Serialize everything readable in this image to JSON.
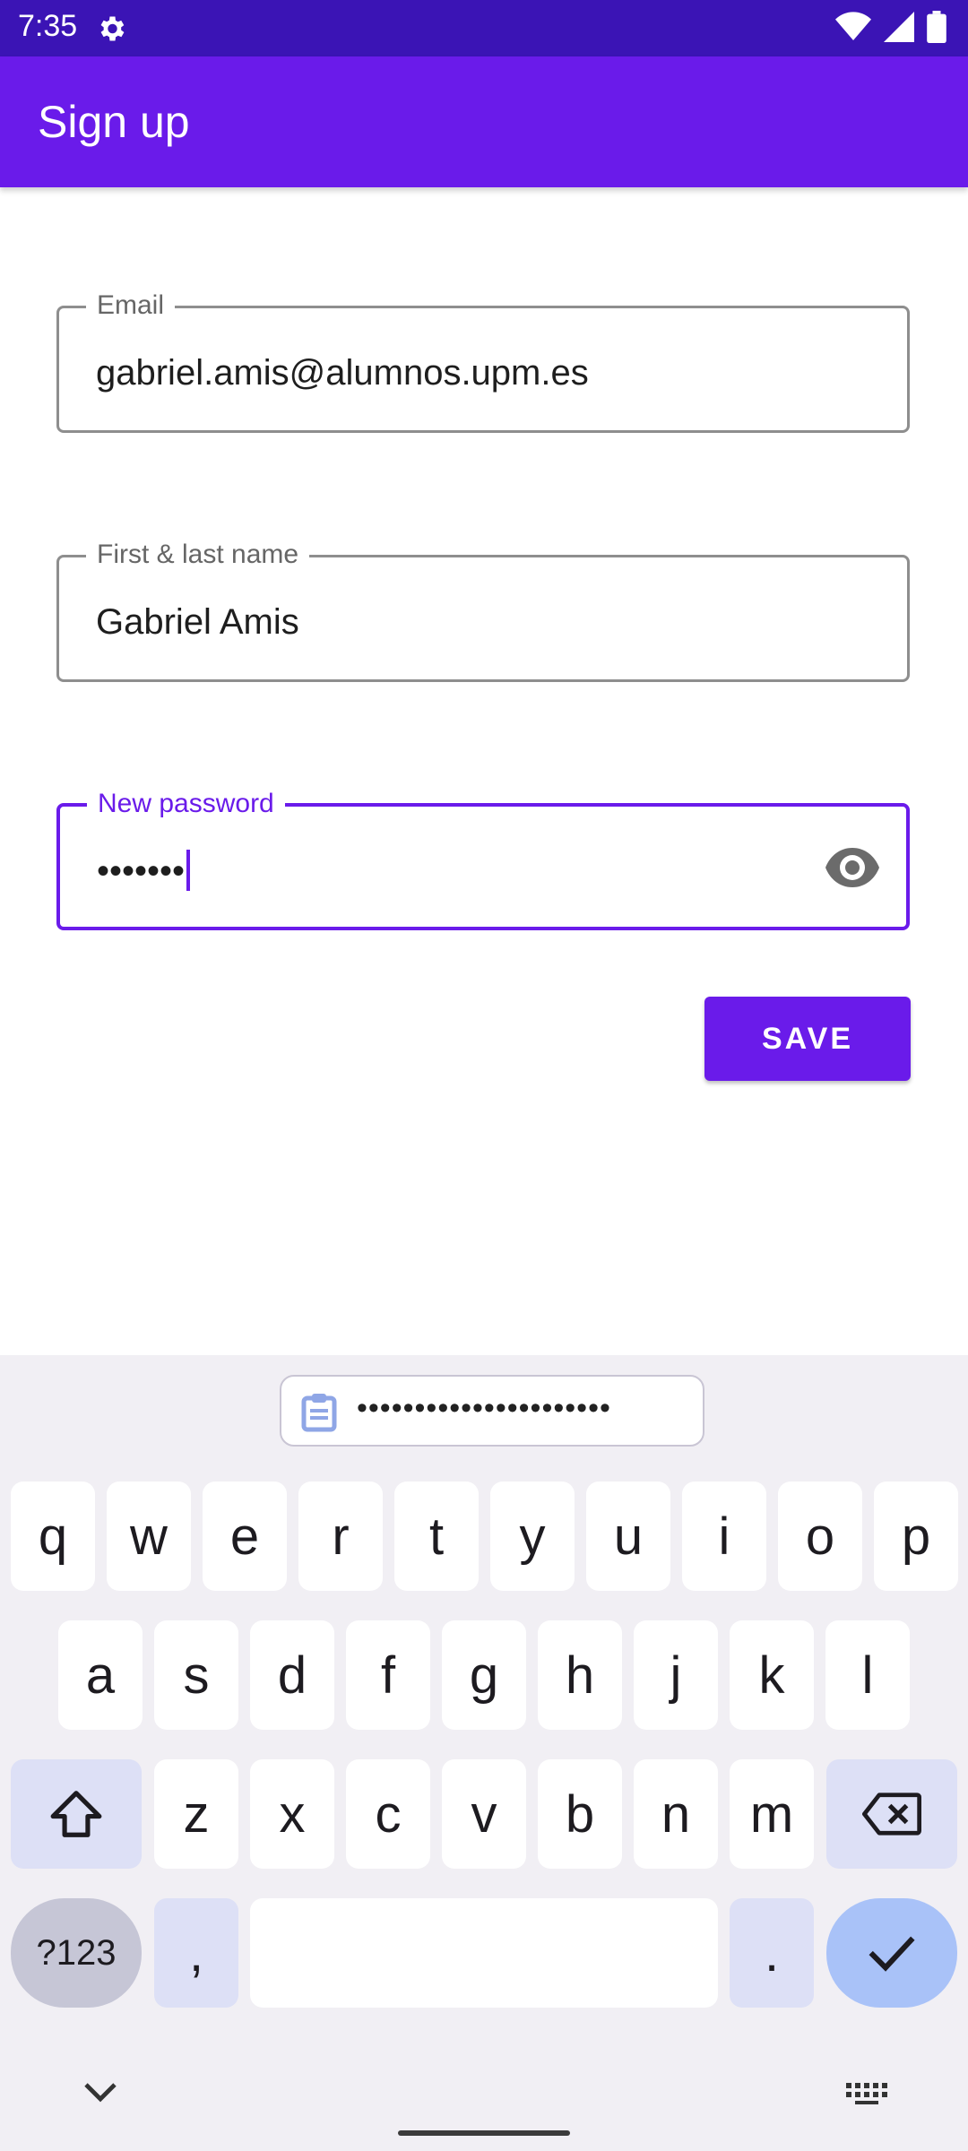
{
  "status_bar": {
    "time": "7:35"
  },
  "app_bar": {
    "title": "Sign up"
  },
  "form": {
    "email": {
      "label": "Email",
      "value": "gabriel.amis@alumnos.upm.es"
    },
    "name": {
      "label": "First & last name",
      "value": "Gabriel Amis"
    },
    "password": {
      "label": "New password",
      "value": "•••••••"
    },
    "save_label": "SAVE"
  },
  "keyboard": {
    "clipboard_suggestion": "••••••••••••••••••••••",
    "row1": [
      "q",
      "w",
      "e",
      "r",
      "t",
      "y",
      "u",
      "i",
      "o",
      "p"
    ],
    "row2": [
      "a",
      "s",
      "d",
      "f",
      "g",
      "h",
      "j",
      "k",
      "l"
    ],
    "row3": [
      "z",
      "x",
      "c",
      "v",
      "b",
      "n",
      "m"
    ],
    "symbols_label": "?123",
    "comma": ",",
    "period": "."
  },
  "colors": {
    "status_bar": "#3B14B5",
    "app_bar": "#6A1BEA",
    "accent": "#6A1BEA"
  }
}
